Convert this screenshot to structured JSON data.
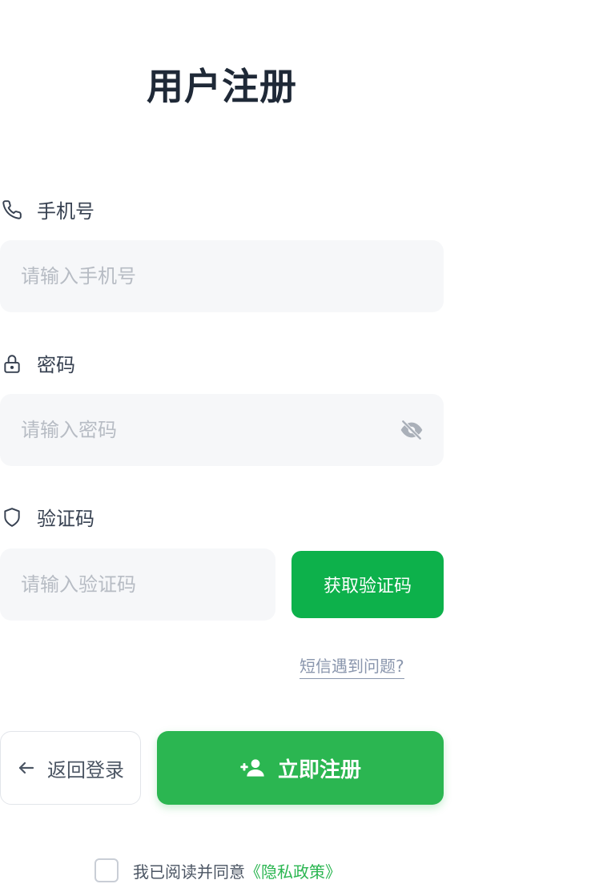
{
  "title": "用户注册",
  "phone": {
    "label": "手机号",
    "icon": "phone-icon",
    "value": "",
    "placeholder": "请输入手机号"
  },
  "password": {
    "label": "密码",
    "icon": "lock-icon",
    "value": "",
    "placeholder": "请输入密码",
    "toggle_icon": "eye-off-icon"
  },
  "code": {
    "label": "验证码",
    "icon": "shield-icon",
    "value": "",
    "placeholder": "请输入验证码",
    "button_label": "获取验证码"
  },
  "help_link": "短信遇到问题?",
  "actions": {
    "back_label": "返回登录",
    "back_icon": "arrow-left-icon",
    "register_label": "立即注册",
    "register_icon": "add-user-icon"
  },
  "agreement": {
    "checked": false,
    "text": "我已阅读并同意",
    "link_label": "《隐私政策》"
  },
  "colors": {
    "primary_green": "#2bb651",
    "code_button_green": "#0db14b",
    "input_bg": "#f6f7f9",
    "placeholder": "#b7bcc4",
    "link_gray": "#8a96ad"
  }
}
